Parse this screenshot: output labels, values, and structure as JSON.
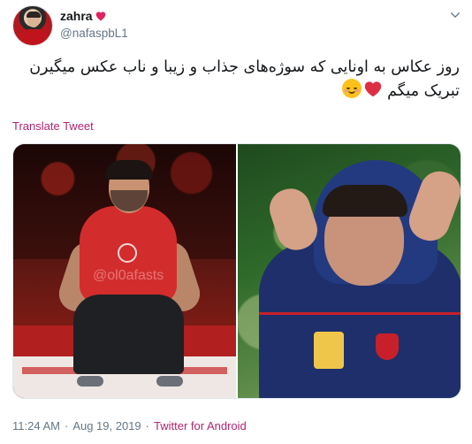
{
  "user": {
    "display_name": "zahra",
    "handle": "@nafaspbL1"
  },
  "tweet": {
    "text_line_1": "روز عکاس به اونایی که  سوژه‌های جذاب و زیبا و ناب عکس میگیرن",
    "text_line_2": "تبریک میگم",
    "emojis": [
      "red-heart-emoji",
      "relieved-face-emoji"
    ]
  },
  "translate_label": "Translate Tweet",
  "media": {
    "photos": [
      {
        "watermark": "@ol0afasts"
      },
      {
        "watermark": ""
      }
    ]
  },
  "footer": {
    "time": "11:24 AM",
    "sep1": "·",
    "date": "Aug 19, 2019",
    "sep2": "·",
    "source": "Twitter for Android"
  },
  "colors": {
    "link": "#b0256f",
    "muted": "#657786",
    "text": "#14171a",
    "heart": "#e0245e"
  }
}
